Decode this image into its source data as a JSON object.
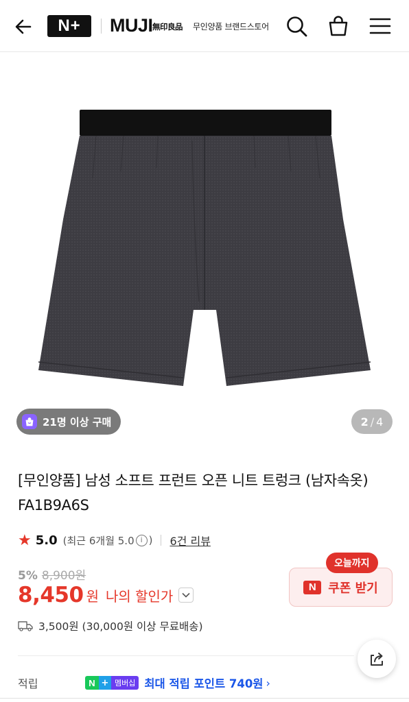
{
  "header": {
    "logo_nplus": "N+",
    "brand": "MUJI",
    "brand_jp": "無印良品",
    "store_name": "무인양품 브랜드스토어"
  },
  "gallery": {
    "buy_badge": "21명 이상 구매",
    "current_page": "2",
    "separator": "/",
    "total_pages": "4"
  },
  "product": {
    "title": "[무인양품] 남성 소프트 프런트 오픈 니트 트렁크 (남자속옷) FA1B9A6S",
    "rating": "5.0",
    "rating_recent": "(최근 6개월 5.0",
    "rating_recent_close": ")",
    "info_icon": "i",
    "review_link": "6건 리뷰",
    "discount_rate": "5%",
    "original_price": "8,900원",
    "price": "8,450",
    "price_unit": "원",
    "my_discount_label": "나의 할인가",
    "shipping": "3,500원 (30,000원 이상 무료배송)"
  },
  "coupon": {
    "tag": "오늘까지",
    "n_mark": "N",
    "label": "쿠폰 받기"
  },
  "points": {
    "label": "적립",
    "badge_n": "N",
    "badge_plus": "+",
    "badge_text": "멤버십",
    "text": "최대 적립 포인트 740원",
    "chevron": "›"
  },
  "colors": {
    "accent_red": "#e5372a",
    "points_blue": "#1a56e8",
    "badge_purple": "#8a63ff"
  },
  "icons": [
    "back-arrow-icon",
    "search-icon",
    "shopping-bag-icon",
    "menu-icon",
    "star-icon",
    "info-icon",
    "chevron-down-icon",
    "truck-icon",
    "share-icon"
  ]
}
